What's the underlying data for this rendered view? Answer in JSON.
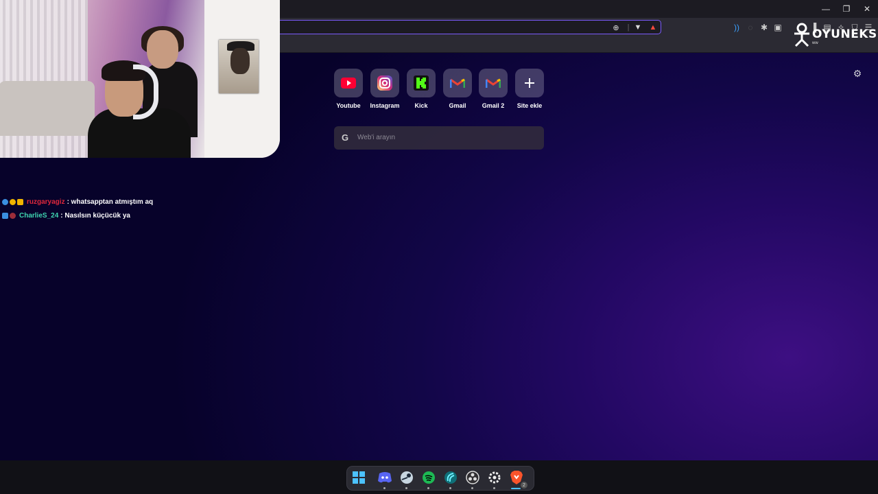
{
  "browser": {
    "window_controls": {
      "minimize": "—",
      "maximize": "❐",
      "close": "✕"
    },
    "toolbar_icons": [
      "zoom-icon",
      "brave-shield-icon",
      "brave-rewards-icon",
      "audio-icon",
      "sync-icon",
      "extensions-icon",
      "tab-search-icon",
      "sidebar-icon",
      "wallet-icon",
      "leo-ai-icon",
      "vpn-icon",
      "menu-icon"
    ],
    "accent_color": "#7c5cff"
  },
  "new_tab": {
    "shortcuts": [
      {
        "label": "Youtube",
        "icon": "youtube-icon",
        "color": "#ff0033"
      },
      {
        "label": "Instagram",
        "icon": "instagram-icon",
        "color": "#d62976"
      },
      {
        "label": "Kick",
        "icon": "kick-icon",
        "color": "#53fc18"
      },
      {
        "label": "Gmail",
        "icon": "gmail-icon",
        "color": "#ea4335"
      },
      {
        "label": "Gmail 2",
        "icon": "gmail-icon",
        "color": "#ea4335"
      },
      {
        "label": "Site ekle",
        "icon": "plus-icon",
        "color": "#ffffff"
      }
    ],
    "search": {
      "placeholder": "Web'i arayın",
      "engine_icon": "google-icon"
    }
  },
  "chat": [
    {
      "user": "ruzgaryagiz",
      "message": ": whatsapptan atmıştım aq",
      "user_color": "#e0283c"
    },
    {
      "user": "CharlieS_24",
      "message": ": Nasılsın küçücük ya",
      "user_color": "#3fd6b0"
    }
  ],
  "overlay_logo": {
    "text": "OYUNEKS",
    "sub": "ww"
  },
  "taskbar": {
    "apps": [
      "start-icon",
      "discord-icon",
      "steam-icon",
      "spotify-icon",
      "app-icon",
      "obs-icon",
      "steelseries-icon",
      "brave-icon"
    ],
    "brave_count": "2"
  }
}
